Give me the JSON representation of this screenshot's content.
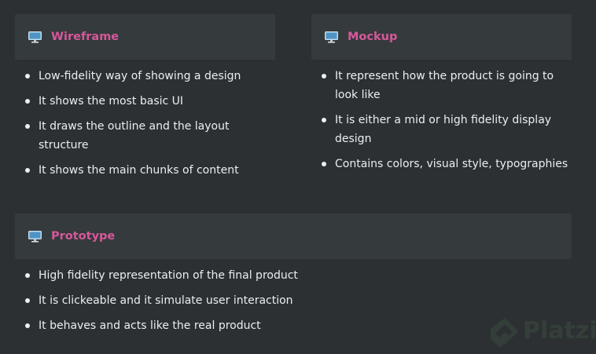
{
  "cards": [
    {
      "title": "Wireframe",
      "icon": "monitor-icon",
      "items": [
        "Low-fidelity way of showing a design",
        "It shows the most basic UI",
        "It draws the outline and the layout structure",
        "It shows the main chunks of content"
      ]
    },
    {
      "title": "Mockup",
      "icon": "monitor-icon",
      "items": [
        "It represent how the product is going to look like",
        "It is either a mid or high fidelity display design",
        "Contains colors, visual style, typographies"
      ]
    },
    {
      "title": "Prototype",
      "icon": "monitor-icon",
      "items": [
        "High fidelity representation of the final product",
        "It is clickeable and it simulate user interaction",
        "It behaves and acts like the real product"
      ]
    }
  ],
  "watermark": "Platzi",
  "colors": {
    "background": "#2c3033",
    "card_header": "#353a3d",
    "title": "#d6589a",
    "text": "#eceef0"
  }
}
